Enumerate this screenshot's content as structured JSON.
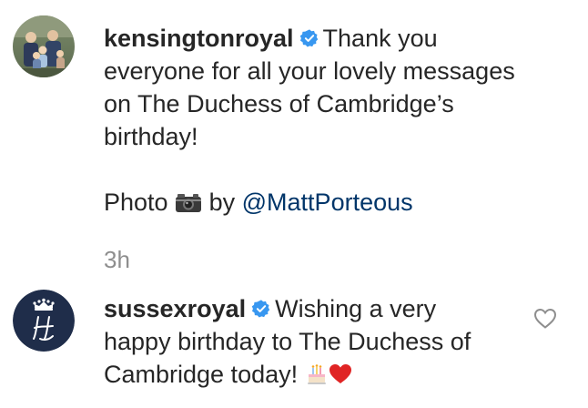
{
  "comments": [
    {
      "username": "kensingtonroyal",
      "verified": true,
      "text_line1": "Thank you",
      "text_line2": "everyone for all your lovely messages",
      "text_line3": "on The Duchess of Cambridge’s",
      "text_line4": "birthday!",
      "photo_word": "Photo",
      "photo_by": "by",
      "mention": "@MattPorteous",
      "time": "3h",
      "avatar_icon": "family-photo-avatar"
    },
    {
      "username": "sussexroyal",
      "verified": true,
      "text_line1": "Wishing a very",
      "text_line2": "happy birthday to The Duchess of",
      "text_line3": "Cambridge today!",
      "avatar_icon": "crown-monogram-avatar",
      "like_icon": "heart-outline-icon"
    }
  ],
  "colors": {
    "username": "#262626",
    "mention": "#003569",
    "timestamp": "#8e8e8e",
    "verified": "#3897f0",
    "sussex_avatar_bg": "#1f2d4a",
    "heart_emoji": "#e02424"
  }
}
